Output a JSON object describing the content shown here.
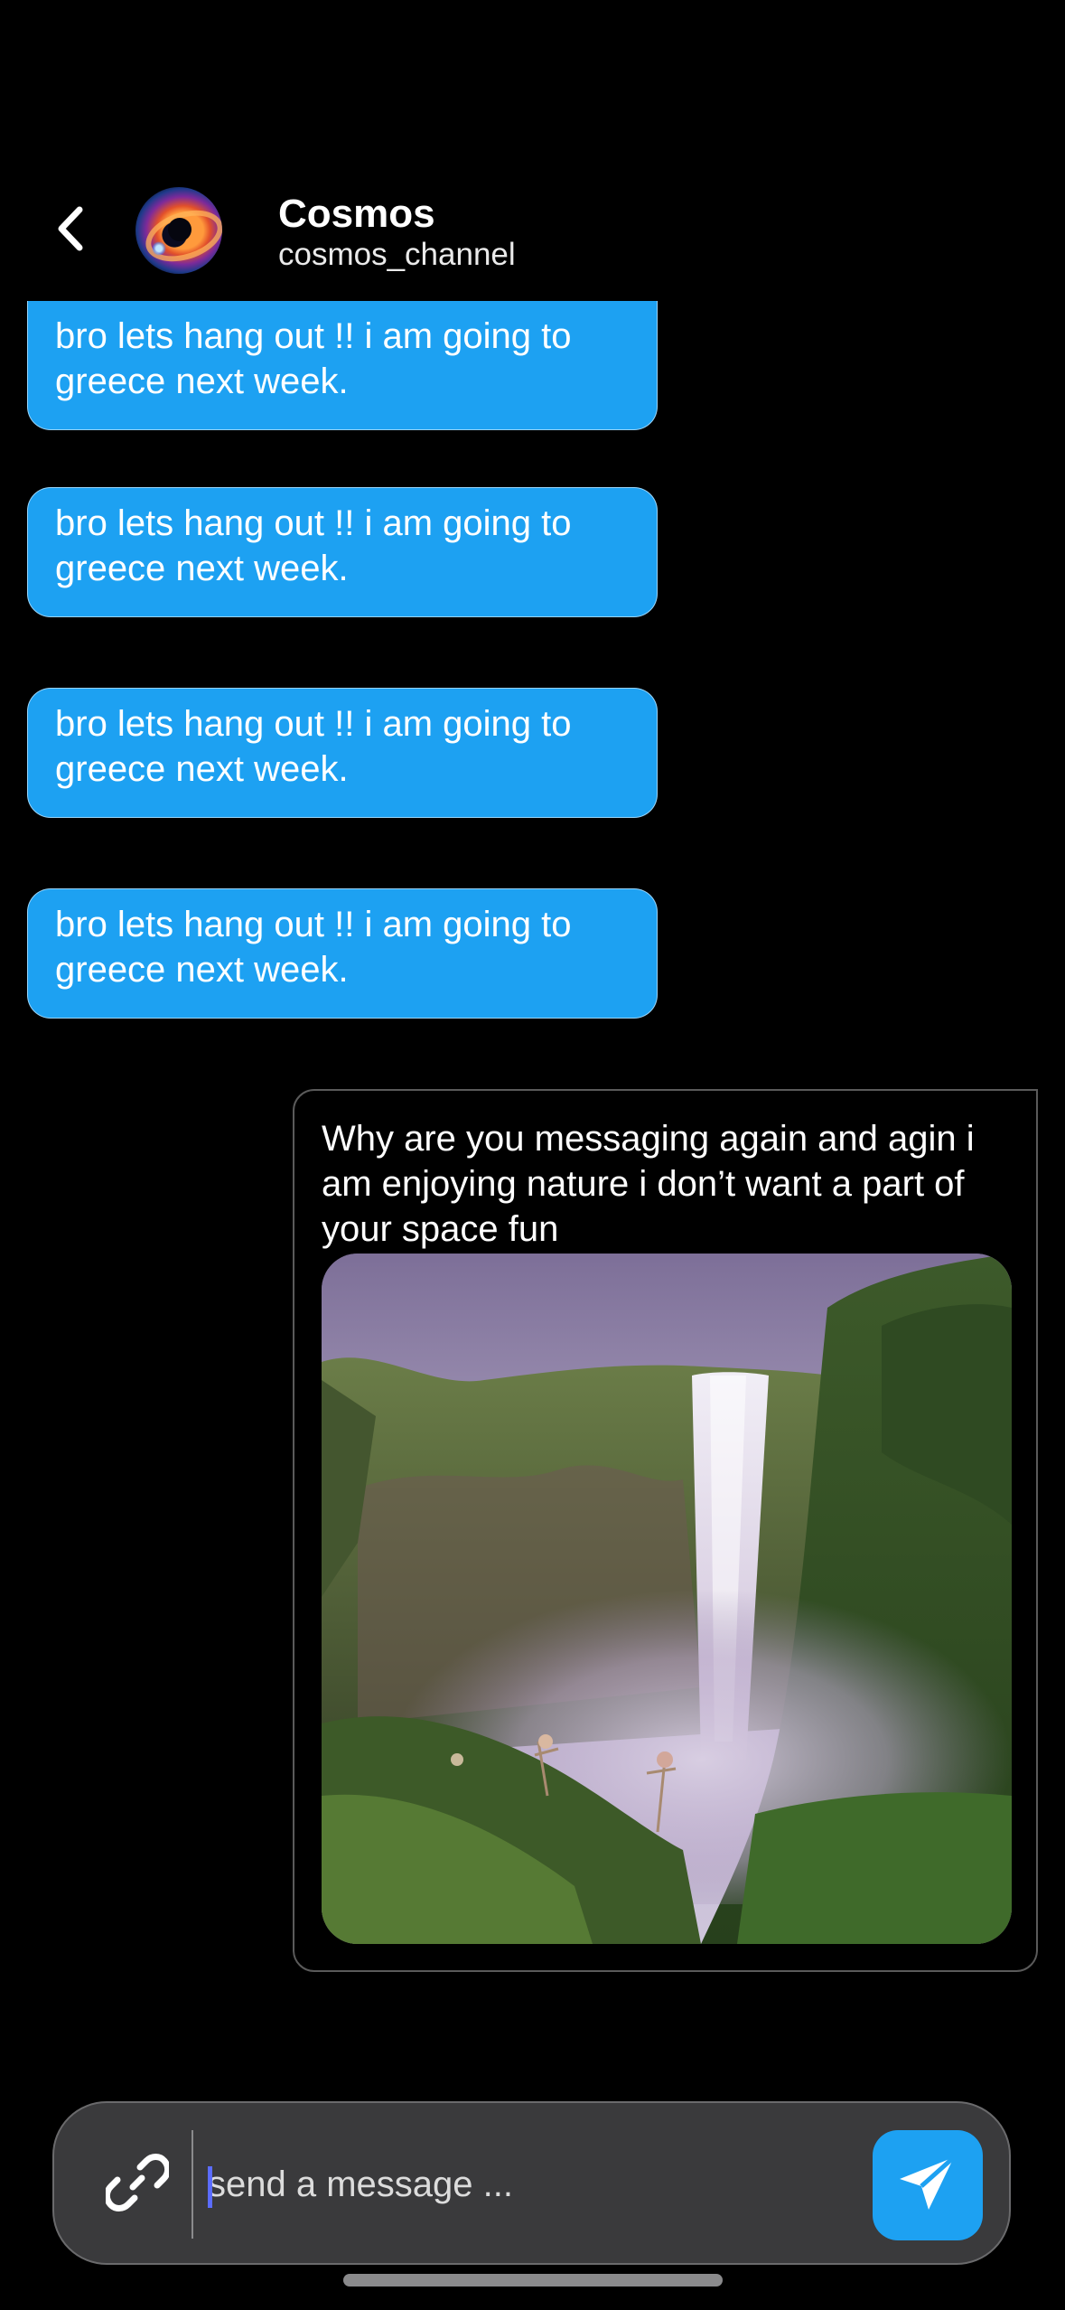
{
  "header": {
    "contact_name": "Cosmos",
    "contact_handle": "cosmos_channel",
    "back_icon": "chevron-left-icon",
    "avatar": "black-hole-avatar"
  },
  "messages": {
    "incoming": [
      {
        "text": "bro lets hang out !! i am going to greece next week."
      },
      {
        "text": "bro lets hang out !! i am going to greece next week."
      },
      {
        "text": "bro lets hang out !! i am going to greece next week."
      },
      {
        "text": "bro lets hang out !! i am going to greece next week."
      }
    ],
    "outgoing": {
      "text": "Why are you messaging again and agin i am enjoying nature i don’t want a part of your space fun",
      "image": "waterfall-photo"
    }
  },
  "composer": {
    "placeholder": "send a message ...",
    "attach_icon": "link-icon",
    "send_icon": "paper-plane-icon"
  },
  "colors": {
    "background": "#000000",
    "bubble_incoming": "#1da1f2",
    "send_button": "#1da1f2",
    "composer_bg": "#3a3a3c"
  }
}
